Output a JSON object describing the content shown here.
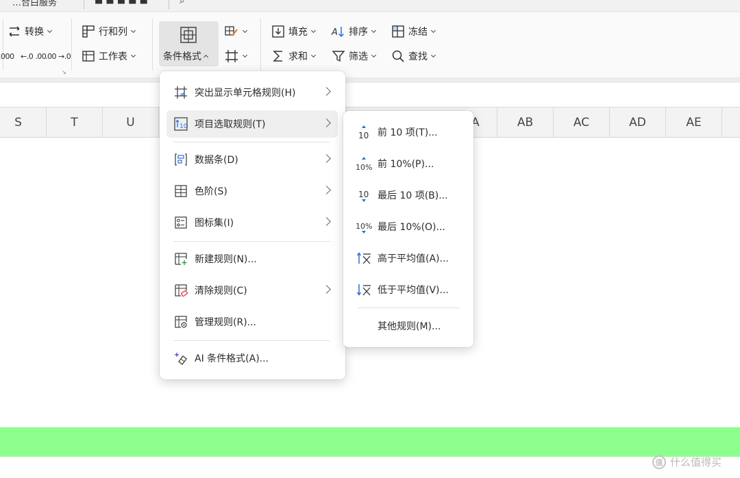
{
  "topbar": {
    "fragment1": "…合白服务",
    "fragment2": "■ ■ ■ ■ ■"
  },
  "ribbon": {
    "convert": "转换",
    "rowcol": "行和列",
    "worksheet": "工作表",
    "conditional_format": "条件格式",
    "fill": "填充",
    "sort": "排序",
    "freeze": "冻结",
    "sum": "求和",
    "filter": "筛选",
    "find": "查找",
    "num_fmt_1": ".000",
    "num_fmt_2": "←.0 .00",
    "num_fmt_3": ".00 →.0"
  },
  "columns": [
    "S",
    "T",
    "U",
    "A",
    "AB",
    "AC",
    "AD",
    "AE"
  ],
  "menu": {
    "items": [
      {
        "label": "突出显示单元格规则(H)",
        "icon": "highlight-rules-icon",
        "has_submenu": true
      },
      {
        "label": "项目选取规则(T)",
        "icon": "top-bottom-rules-icon",
        "has_submenu": true
      },
      {
        "label": "数据条(D)",
        "icon": "data-bars-icon",
        "has_submenu": true
      },
      {
        "label": "色阶(S)",
        "icon": "color-scales-icon",
        "has_submenu": true
      },
      {
        "label": "图标集(I)",
        "icon": "icon-sets-icon",
        "has_submenu": true
      },
      {
        "label": "新建规则(N)...",
        "icon": "new-rule-icon",
        "has_submenu": false
      },
      {
        "label": "清除规则(C)",
        "icon": "clear-rules-icon",
        "has_submenu": true
      },
      {
        "label": "管理规则(R)...",
        "icon": "manage-rules-icon",
        "has_submenu": false
      },
      {
        "label": "AI 条件格式(A)...",
        "icon": "ai-format-icon",
        "has_submenu": false
      }
    ]
  },
  "submenu": {
    "items": [
      {
        "label": "前 10 项(T)...",
        "icon": "top-10-items-icon"
      },
      {
        "label": "前 10%(P)...",
        "icon": "top-10-percent-icon"
      },
      {
        "label": "最后 10 项(B)...",
        "icon": "bottom-10-items-icon"
      },
      {
        "label": "最后 10%(O)...",
        "icon": "bottom-10-percent-icon"
      },
      {
        "label": "高于平均值(A)...",
        "icon": "above-average-icon"
      },
      {
        "label": "低于平均值(V)...",
        "icon": "below-average-icon"
      },
      {
        "label": "其他规则(M)...",
        "icon": ""
      }
    ]
  },
  "watermark": {
    "text": "什么值得买"
  },
  "colors": {
    "accent_blue": "#2a6fdb",
    "green_bar": "#8cff8c",
    "ai_purple": "#7b4be3",
    "clear_red": "#e0464f"
  }
}
